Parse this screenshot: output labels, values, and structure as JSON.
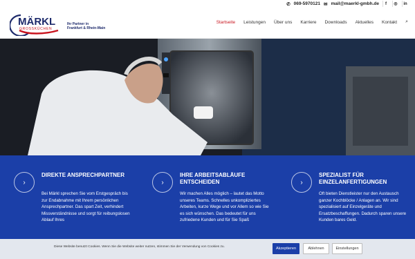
{
  "topbar": {
    "phone": "069-5970121",
    "email": "mail@maerkl-gmbh.de",
    "social": [
      "f",
      "◎",
      "in"
    ]
  },
  "logo": {
    "brand": "MÄRKL",
    "sub": "GROSSKÜCHEN",
    "tagline_1": "Ihr Partner in",
    "tagline_2": "Frankfurt & Rhein-Main"
  },
  "nav": {
    "items": [
      "Startseite",
      "Leistungen",
      "Über uns",
      "Karriere",
      "Downloads",
      "Aktuelles",
      "Kontakt"
    ],
    "active_index": 0
  },
  "features": [
    {
      "title": "Direkte Ansprechpartner",
      "text": "Bei Märkl sprechen Sie vom Erstgespräch bis zur Endabnahme mit Ihrem persönlichen Ansprechpartner. Das spart Zeit, verhindert Missverständnisse und sorgt für reibungslosen Ablauf Ihres"
    },
    {
      "title": "Ihre Arbeitsabläufe entscheiden",
      "text": "Wir machen Alles möglich – lautet das Motto unseres Teams. Schnelles unkompliziertes Arbeiten, kurze Wege und vor Allem so wie Sie es sich wünschen. Das bedeutet für uns zufriedene Kunden und für Sie Spaß"
    },
    {
      "title": "Spezialist für Einzelanfertigungen",
      "text": "Oft bieten Dienstleister nur den Austausch ganzer Kochblöcke / Anlagen an. Wir sind spezialisiert auf Einzelgeräte und Ersatzbeschaffungen. Dadurch sparen unsere Kunden bares Geld."
    }
  ],
  "cookie": {
    "message": "Diese Website benutzt Cookies. Wenn Sie die Website weiter nutzen, stimmen Sie der Verwendung von Cookies zu.",
    "accept": "Akzeptieren",
    "reject": "Ablehnen",
    "settings": "Einstellungen"
  },
  "colors": {
    "brand_blue": "#1b3fa8",
    "brand_red": "#c8141e",
    "navy": "#1d2a6b"
  },
  "icons": {
    "phone": "phone-icon",
    "mail": "mail-icon",
    "search": "search-icon",
    "chevron": "chevron-right-icon"
  }
}
